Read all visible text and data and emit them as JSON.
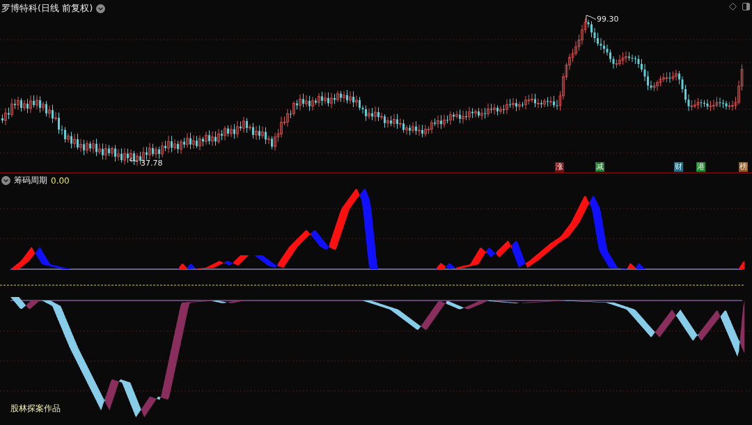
{
  "stock_panel": {
    "title": "罗博特科(日线 前复权)",
    "high_label": "99.30",
    "low_label": "37.78",
    "event_tags": [
      {
        "label": "涨",
        "color": "#7a1414"
      },
      {
        "label": "减",
        "color": "#1d7a2c"
      },
      {
        "label": "财",
        "color": "#1f6d86"
      },
      {
        "label": "港",
        "color": "#1b8a2c"
      },
      {
        "label": "榜",
        "color": "#9a5a1c"
      }
    ]
  },
  "indicator_panel": {
    "name": "筹码周期",
    "value": "0.00",
    "credit": "股林探案作品"
  }
}
